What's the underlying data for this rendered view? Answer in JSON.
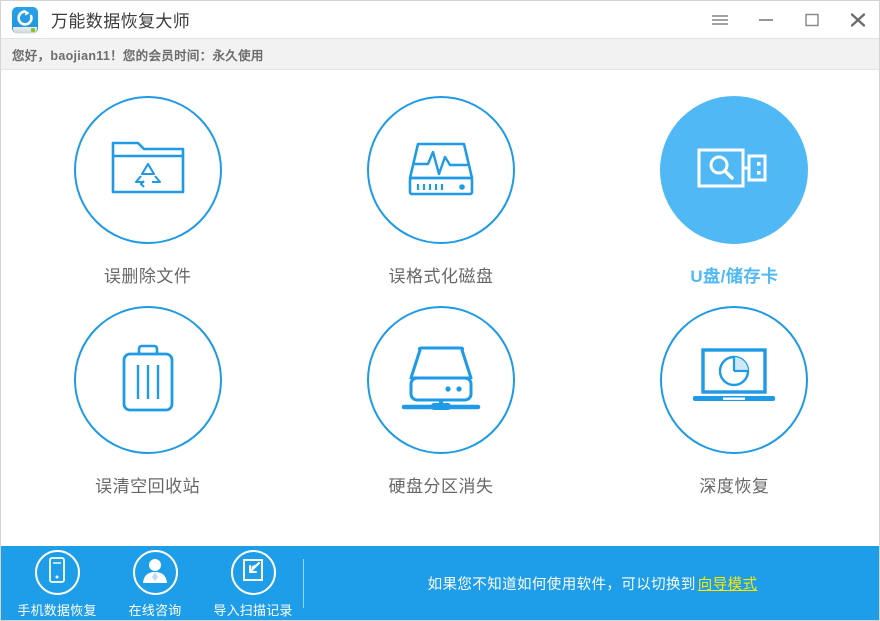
{
  "window": {
    "title": "万能数据恢复大师",
    "logo_icon": "refresh-circle-icon"
  },
  "titlebar": {
    "menu_icon": "hamburger-menu-icon",
    "minimize_icon": "minimize-icon",
    "maximize_icon": "maximize-icon",
    "close_icon": "close-icon"
  },
  "subheader": {
    "greeting": "您好，baojian11！您的会员时间：永久使用"
  },
  "main": {
    "cards": [
      {
        "id": "deleted-files",
        "label": "误删除文件",
        "icon": "folder-recycle-icon",
        "active": false
      },
      {
        "id": "formatted-disk",
        "label": "误格式化磁盘",
        "icon": "disk-waveform-icon",
        "active": false
      },
      {
        "id": "usb-memory-card",
        "label": "U盘/储存卡",
        "icon": "usb-search-icon",
        "active": true
      },
      {
        "id": "emptied-recyclebin",
        "label": "误清空回收站",
        "icon": "trash-bin-icon",
        "active": false
      },
      {
        "id": "lost-partition",
        "label": "硬盘分区消失",
        "icon": "hard-disk-icon",
        "active": false
      },
      {
        "id": "deep-recovery",
        "label": "深度恢复",
        "icon": "laptop-scan-icon",
        "active": false
      }
    ]
  },
  "bottombar": {
    "quick_actions": [
      {
        "id": "phone-recovery",
        "label": "手机数据恢复",
        "icon": "mobile-phone-icon"
      },
      {
        "id": "online-consult",
        "label": "在线咨询",
        "icon": "support-person-icon"
      },
      {
        "id": "import-scan-log",
        "label": "导入扫描记录",
        "icon": "import-arrow-icon"
      }
    ],
    "hint_prefix": "如果您不知道如何使用软件，可以切换到",
    "hint_link": "向导模式"
  },
  "colors": {
    "accent": "#1e9de8",
    "active_card": "#4fb8f5",
    "icon_blue": "#1e9ae6",
    "link_yellow": "#ffe800",
    "label_gray": "#676767"
  }
}
